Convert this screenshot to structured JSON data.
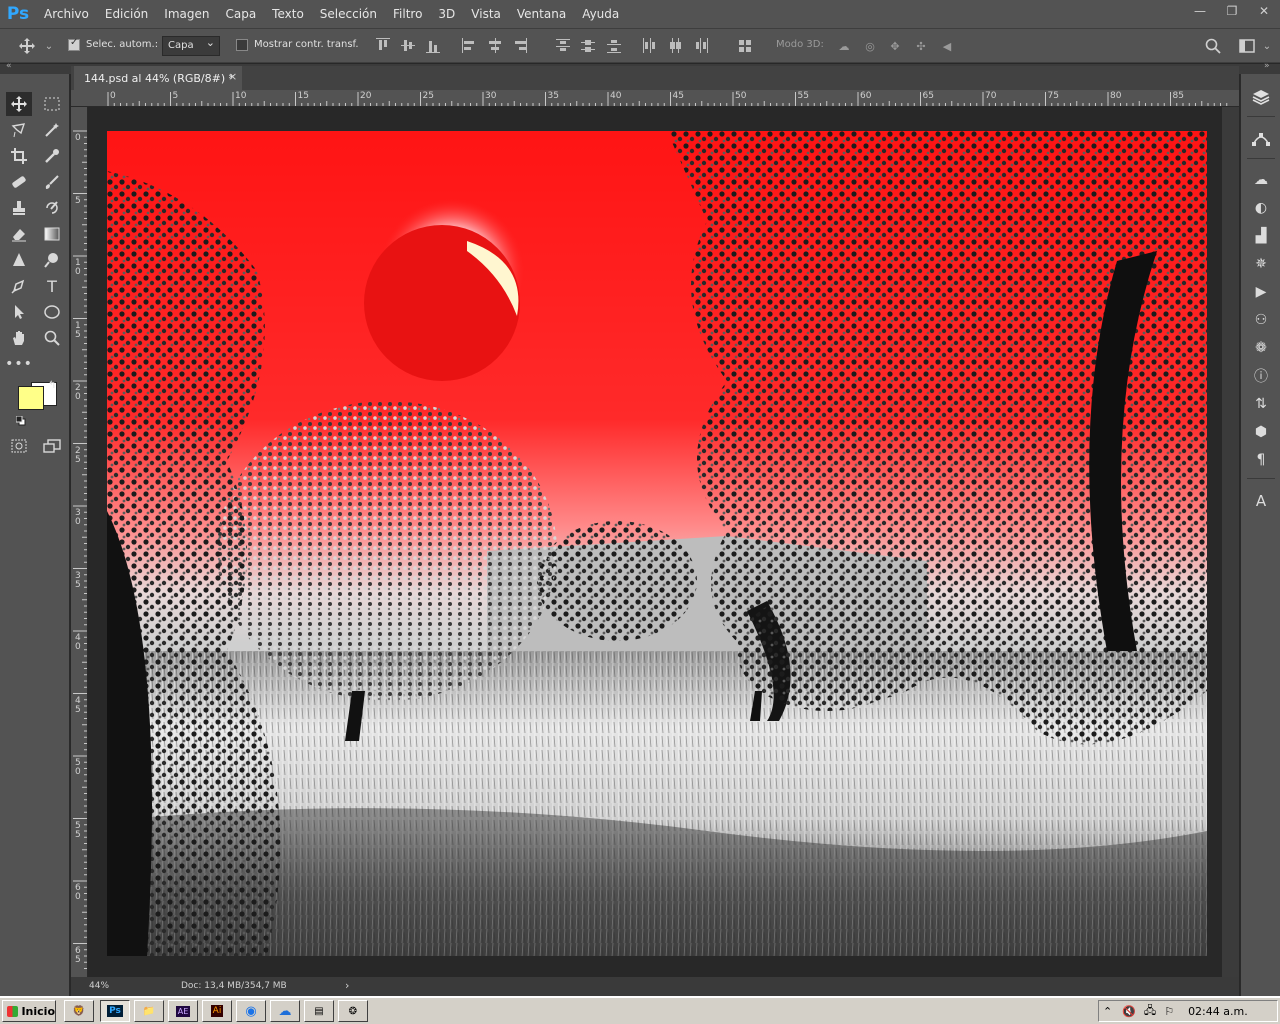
{
  "app": {
    "logo": "Ps"
  },
  "menu": [
    "Archivo",
    "Edición",
    "Imagen",
    "Capa",
    "Texto",
    "Selección",
    "Filtro",
    "3D",
    "Vista",
    "Ventana",
    "Ayuda"
  ],
  "window_controls": {
    "minimize": "—",
    "restore": "❐",
    "close": "✕"
  },
  "options": {
    "auto_select_label": "Selec. autom.:",
    "auto_select_checked": true,
    "auto_select_target": "Capa",
    "show_transform_label": "Mostrar contr. transf.",
    "show_transform_checked": false,
    "mode_3d_label": "Modo 3D:"
  },
  "document": {
    "tab_title": "144.psd al 44% (RGB/8#) *",
    "tab_close": "×",
    "zoom": "44%",
    "doc_info": "Doc: 13,4 MB/354,7 MB",
    "status_arrow": "›"
  },
  "ruler_h": [
    "0",
    "5",
    "10",
    "15",
    "20",
    "25",
    "30",
    "35",
    "40",
    "45",
    "50",
    "55",
    "60",
    "65",
    "70",
    "75",
    "80",
    "85"
  ],
  "ruler_v": [
    "0",
    "5",
    "10",
    "15",
    "20",
    "25",
    "30",
    "35",
    "40",
    "45",
    "50",
    "55",
    "60",
    "65"
  ],
  "colors": {
    "foreground": "#ffff88",
    "background": "#ffffff",
    "ps_blue": "#31a8ff",
    "sky_red": "#ff1a1a"
  },
  "taskbar": {
    "start_label": "Inicio",
    "apps": [
      {
        "name": "brave",
        "glyph": "🦁"
      },
      {
        "name": "photoshop",
        "glyph": "Ps"
      },
      {
        "name": "explorer",
        "glyph": "📁"
      },
      {
        "name": "after-effects",
        "glyph": "AE"
      },
      {
        "name": "illustrator",
        "glyph": "Ai"
      },
      {
        "name": "chrome",
        "glyph": "◉"
      },
      {
        "name": "cloud",
        "glyph": "☁"
      },
      {
        "name": "notepad",
        "glyph": "▤"
      },
      {
        "name": "misc",
        "glyph": "❂"
      }
    ],
    "clock": "02:44 a.m."
  }
}
